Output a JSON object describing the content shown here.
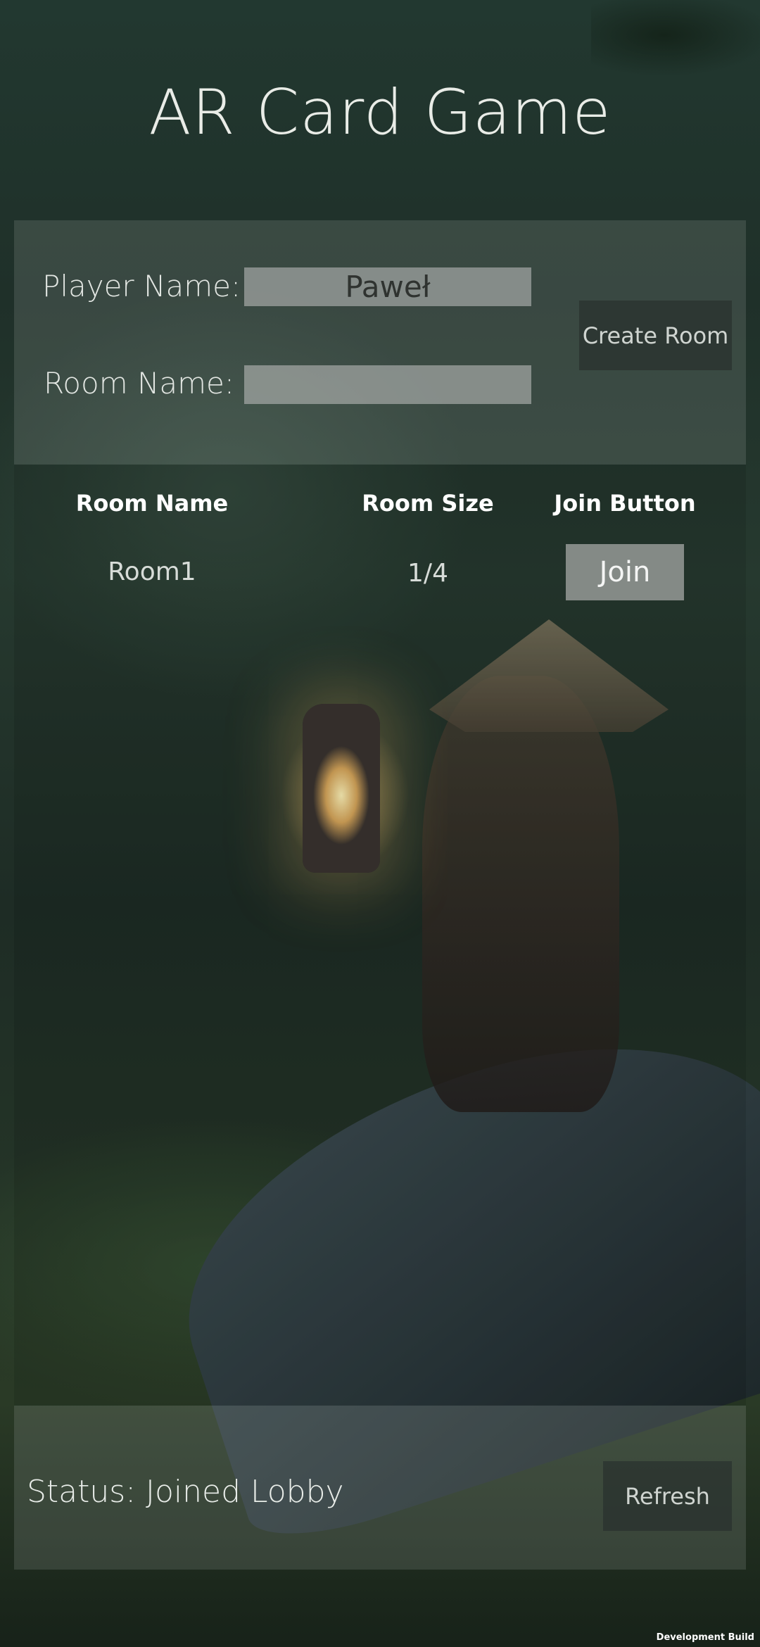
{
  "app": {
    "title": "AR Card Game"
  },
  "form": {
    "player_name_label": "Player Name:",
    "player_name_value": "Paweł",
    "room_name_label": "Room Name:",
    "room_name_value": "",
    "create_room_label": "Create Room"
  },
  "room_list": {
    "headers": [
      "Room Name",
      "Room Size",
      "Join Button"
    ],
    "rows": [
      {
        "name": "Room1",
        "size": "1/4",
        "join_label": "Join"
      }
    ]
  },
  "footer": {
    "status_text": "Status: Joined Lobby",
    "refresh_label": "Refresh"
  },
  "build_label": "Development Build"
}
